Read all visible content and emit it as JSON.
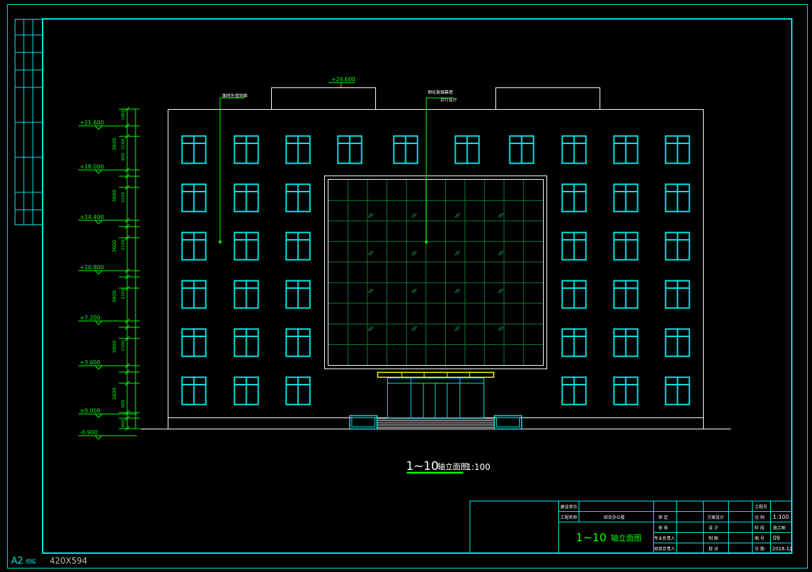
{
  "sheet": {
    "size_label": "A2",
    "size_suffix": "图幅",
    "dimensions": "420X594"
  },
  "drawing": {
    "title_main": "1~10",
    "title_text": "轴立面图",
    "scale": "1:100",
    "top_elevation": "+24.600",
    "callout_left": "面砖外墙饰面",
    "callout_right_line1": "钢化玻璃幕墙",
    "callout_right_line2": "另行设计",
    "elevations": [
      "+21.600",
      "+18.000",
      "+14.400",
      "+10.800",
      "+7.200",
      "+3.600",
      "±0.000",
      "-0.900"
    ],
    "dims_main": [
      "3600",
      "3600",
      "3600",
      "3600",
      "3600",
      "3600"
    ],
    "dims_sub": [
      "900",
      "2100",
      "900",
      "1400",
      "900",
      "600"
    ]
  },
  "title_block": {
    "row1_label": "建设单位",
    "row2_label": "工程名称",
    "project_name": "综合办公楼",
    "drawing_name_main": "1~10",
    "drawing_name_text": "轴立面图",
    "sign_labels": [
      "审 定",
      "审 核",
      "专业负责人",
      "项目负责人"
    ],
    "role_labels": [
      "方案设计",
      "设 计",
      "制 图",
      "校 对"
    ],
    "info_labels": [
      "工程号",
      "比 例",
      "阶 段",
      "图 号",
      "日 期"
    ],
    "scale_value": "1:100",
    "stage_value": "施工图",
    "sheet_no": "09",
    "date": "2016.12"
  },
  "colors": {
    "frame": "#00e5e5",
    "window": "#00e5e5",
    "building": "#ffffff",
    "dim": "#00ff00",
    "glass_grid": "#0f7a3a",
    "canopy": "#ffff00",
    "title": "#ffffff"
  }
}
